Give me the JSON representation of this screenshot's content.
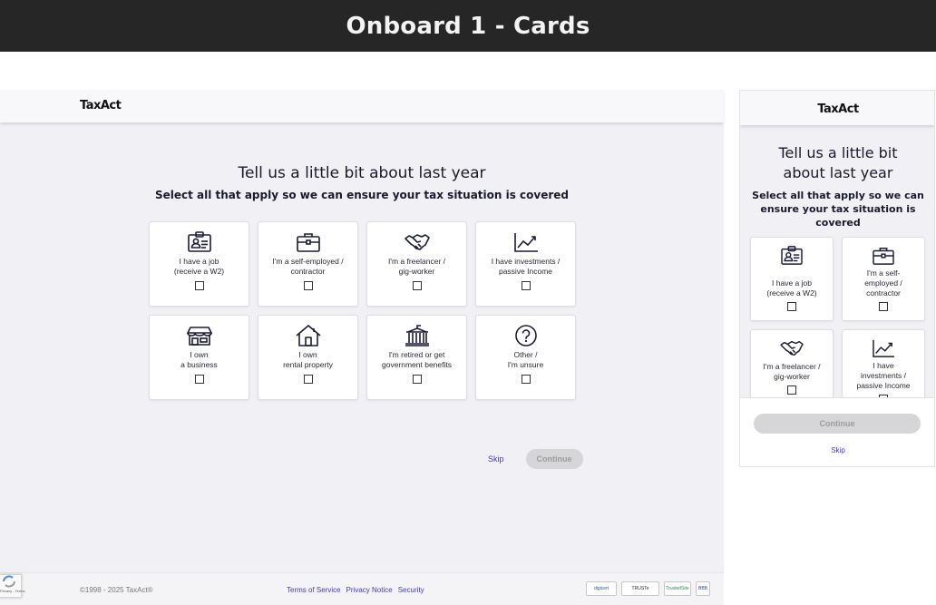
{
  "banner": {
    "title": "Onboard 1 - Cards"
  },
  "brand": {
    "logo": "TaxAct",
    "accent": "#3e3bb8",
    "background": "#f1f0f5",
    "icon_color": "#1d1b3a"
  },
  "desktop": {
    "title": "Tell us a little bit about last year",
    "subtitle": "Select all that apply so we can ensure your tax situation is covered",
    "cards": [
      {
        "icon": "id-badge-icon",
        "label": "I have a job\n(receive a W2)",
        "checked": false
      },
      {
        "icon": "briefcase-icon",
        "label": "I'm a self-employed /\ncontractor",
        "checked": false
      },
      {
        "icon": "handshake-icon",
        "label": "I'm a freelancer /\ngig-worker",
        "checked": false
      },
      {
        "icon": "trend-chart-icon",
        "label": "I have investments /\npassive Income",
        "checked": false
      },
      {
        "icon": "storefront-icon",
        "label": "I own\na business",
        "checked": false
      },
      {
        "icon": "house-icon",
        "label": "I own\nrental property",
        "checked": false
      },
      {
        "icon": "government-building-icon",
        "label": "I'm retired or get\ngovernment benefits",
        "checked": false
      },
      {
        "icon": "question-circle-icon",
        "label": "Other /\nI'm unsure",
        "checked": false
      }
    ],
    "skip_label": "Skip",
    "continue_label": "Continue",
    "footer": {
      "copyright": "©1998 - 2025 TaxAct®",
      "links": [
        "Terms of Service",
        "Privacy Notice",
        "Security"
      ],
      "badges": [
        "digicert",
        "TRUSTe",
        "TrustedSite",
        "BBB"
      ]
    },
    "recaptcha": "Privacy - Terms"
  },
  "mobile": {
    "title_line1": "Tell us a little bit",
    "title_line2": "about last year",
    "subtitle": "Select all that apply so we can ensure your tax situation is covered",
    "cards": [
      {
        "icon": "id-badge-icon",
        "label": "I have a job\n(receive a W2)"
      },
      {
        "icon": "briefcase-icon",
        "label": "I'm a self-\nemployed /\ncontractor"
      },
      {
        "icon": "handshake-icon",
        "label": "I'm a freelancer /\ngig-worker"
      },
      {
        "icon": "trend-chart-icon",
        "label": "I have\ninvestments /\npassive Income"
      }
    ],
    "continue_label": "Continue",
    "skip_label": "Skip"
  }
}
